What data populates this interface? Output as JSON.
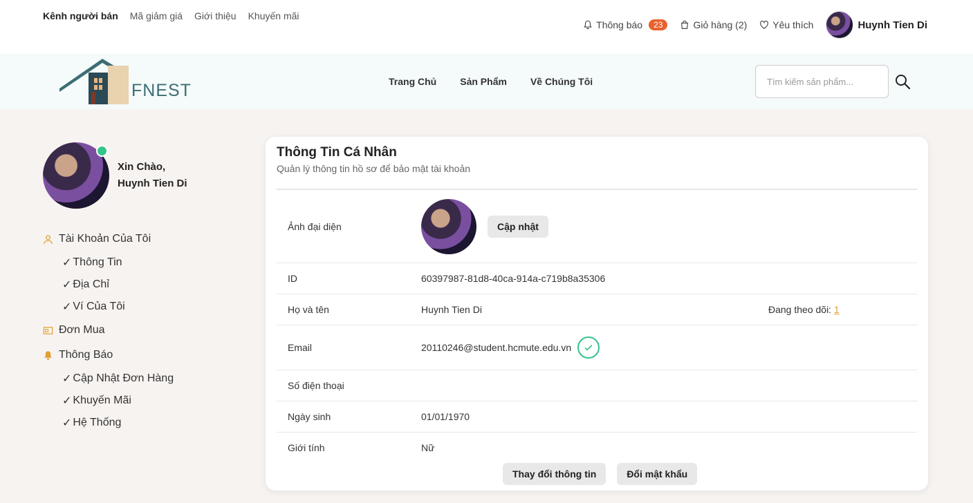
{
  "topbar": {
    "links": [
      "Kênh người bán",
      "Mã giảm giá",
      "Giới thiệu",
      "Khuyến mãi"
    ],
    "notifications": {
      "label": "Thông báo",
      "count": "23"
    },
    "cart": "Giỏ hàng (2)",
    "favorites": "Yêu thích",
    "user_name": "Huynh Tien Di"
  },
  "header": {
    "brand": "FNEST",
    "nav": [
      "Trang Chủ",
      "Sản Phẩm",
      "Về Chúng Tôi"
    ],
    "search_placeholder": "Tìm kiếm sản phẩm..."
  },
  "sidebar": {
    "greeting": "Xin Chào,",
    "name": "Huynh Tien Di",
    "account": {
      "label": "Tài Khoản Của Tôi",
      "items": [
        "Thông Tin",
        "Địa Chỉ",
        "Ví Của Tôi"
      ]
    },
    "orders": "Đơn Mua",
    "notifications": {
      "label": "Thông Báo",
      "items": [
        "Cập Nhật Đơn Hàng",
        "Khuyến Mãi",
        "Hệ Thống"
      ]
    }
  },
  "profile": {
    "title": "Thông Tin Cá Nhân",
    "subtitle": "Quản lý thông tin hồ sơ để bảo mật tài khoản",
    "avatar_label": "Ảnh đại diện",
    "update_button": "Cập nhật",
    "id_label": "ID",
    "id_value": "60397987-81d8-40ca-914a-c719b8a35306",
    "name_label": "Họ và tên",
    "name_value": "Huynh Tien Di",
    "following_label": "Đang theo dõi:",
    "following_count": "1",
    "email_label": "Email",
    "email_value": "20110246@student.hcmute.edu.vn",
    "phone_label": "Số điện thoại",
    "phone_value": "",
    "dob_label": "Ngày sinh",
    "dob_value": "01/01/1970",
    "gender_label": "Giới tính",
    "gender_value": "Nữ",
    "edit_button": "Thay đổi thông tin",
    "password_button": "Đổi mật khẩu"
  },
  "colors": {
    "accent": "#e8622f",
    "verified": "#33c48b",
    "brand": "#3c6e73",
    "link": "#e0a030"
  }
}
